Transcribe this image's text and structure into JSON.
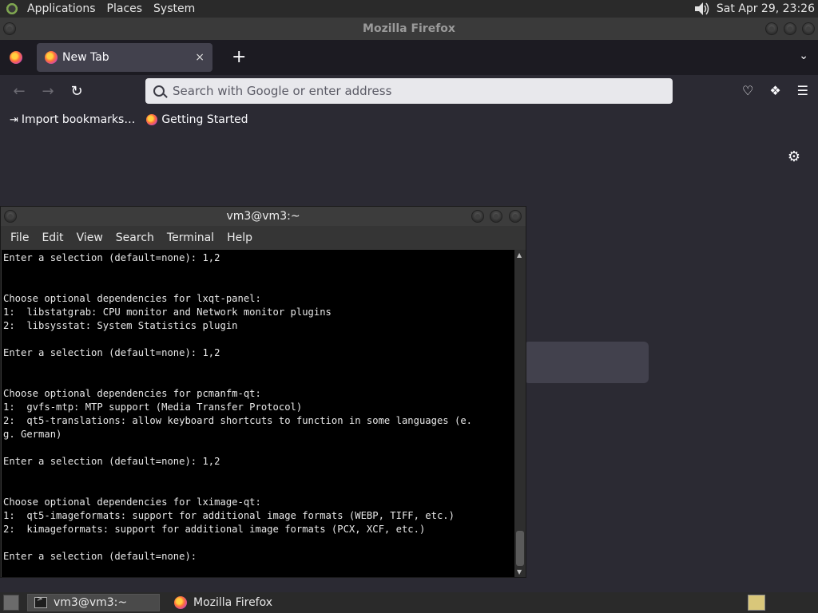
{
  "top_panel": {
    "menus": [
      "Applications",
      "Places",
      "System"
    ],
    "clock": "Sat Apr 29, 23:26"
  },
  "firefox": {
    "window_title": "Mozilla Firefox",
    "tab_title": "New Tab",
    "tab_close": "×",
    "new_tab": "+",
    "url_placeholder": "Search with Google or enter address",
    "bookmarks": [
      "Import bookmarks…",
      "Getting Started"
    ]
  },
  "terminal": {
    "title": "vm3@vm3:~",
    "menu": [
      "File",
      "Edit",
      "View",
      "Search",
      "Terminal",
      "Help"
    ],
    "lines": [
      "Enter a selection (default=none): 1,2",
      "",
      "",
      "Choose optional dependencies for lxqt-panel:",
      "1:  libstatgrab: CPU monitor and Network monitor plugins",
      "2:  libsysstat: System Statistics plugin",
      "",
      "Enter a selection (default=none): 1,2",
      "",
      "",
      "Choose optional dependencies for pcmanfm-qt:",
      "1:  gvfs-mtp: MTP support (Media Transfer Protocol)",
      "2:  qt5-translations: allow keyboard shortcuts to function in some languages (e.",
      "g. German)",
      "",
      "Enter a selection (default=none): 1,2",
      "",
      "",
      "Choose optional dependencies for lximage-qt:",
      "1:  qt5-imageformats: support for additional image formats (WEBP, TIFF, etc.)",
      "2:  kimageformats: support for additional image formats (PCX, XCF, etc.)",
      "",
      "Enter a selection (default=none): "
    ]
  },
  "taskbar": {
    "tasks": [
      "vm3@vm3:~",
      "Mozilla Firefox"
    ]
  }
}
